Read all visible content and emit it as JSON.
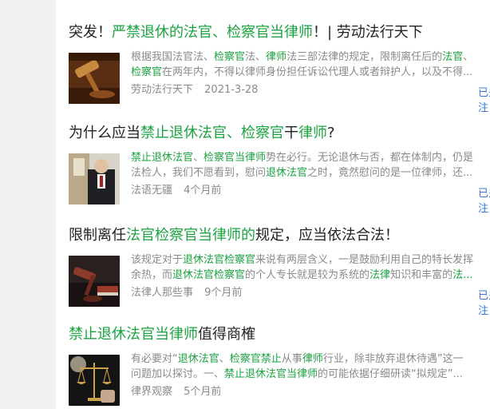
{
  "articles": [
    {
      "title": [
        {
          "t": "突发！",
          "h": false
        },
        {
          "t": "严禁退休的法官、检察官当律师",
          "h": true
        },
        {
          "t": "！| 劳动法行天下",
          "h": false
        }
      ],
      "summary_lines": [
        [
          {
            "t": "根据我国法官法、",
            "h": false
          },
          {
            "t": "检察官",
            "h": true
          },
          {
            "t": "法、",
            "h": false
          },
          {
            "t": "律师",
            "h": true
          },
          {
            "t": "法三部法律的规定，限制离任后的",
            "h": false
          },
          {
            "t": "法官",
            "h": true
          },
          {
            "t": "、",
            "h": false
          }
        ],
        [
          {
            "t": "检察官",
            "h": true
          },
          {
            "t": "在两年内，不得以律师身份担任诉讼代理人或者辩护人，以及不得...",
            "h": false
          }
        ]
      ],
      "source": "劳动法行天下",
      "date": "2021-3-28",
      "follow": "已关注"
    },
    {
      "title": [
        {
          "t": "为什么应当",
          "h": false
        },
        {
          "t": "禁止退休法官、检察官",
          "h": true
        },
        {
          "t": "干",
          "h": false
        },
        {
          "t": "律师",
          "h": true
        },
        {
          "t": "?",
          "h": false
        }
      ],
      "summary_lines": [
        [
          {
            "t": "禁止退休法官",
            "h": true
          },
          {
            "t": "、",
            "h": false
          },
          {
            "t": "检察官当律师",
            "h": true
          },
          {
            "t": "势在必行。无论退休与否，都在体制内，仍是",
            "h": false
          }
        ],
        [
          {
            "t": "法检人，我们不愿看到，慰问",
            "h": false
          },
          {
            "t": "退休法官",
            "h": true
          },
          {
            "t": "之时，竟然慰问的是一位律师，还...",
            "h": false
          }
        ]
      ],
      "source": "法语无疆",
      "date": "4个月前",
      "follow": "已关注"
    },
    {
      "title": [
        {
          "t": "限制离任",
          "h": false
        },
        {
          "t": "法官检察官当律师的",
          "h": true
        },
        {
          "t": "规定，应当依法合法！",
          "h": false
        }
      ],
      "summary_lines": [
        [
          {
            "t": "该规定对于",
            "h": false
          },
          {
            "t": "退休法官检察官",
            "h": true
          },
          {
            "t": "来说有两层含义，一是鼓励利用自己的特长发挥",
            "h": false
          }
        ],
        [
          {
            "t": "余热，而",
            "h": false
          },
          {
            "t": "退休法官检察官",
            "h": true
          },
          {
            "t": "的个人专长就是较为系统的",
            "h": false
          },
          {
            "t": "法律",
            "h": true
          },
          {
            "t": "知识和丰富的",
            "h": false
          },
          {
            "t": "法...",
            "h": true
          }
        ]
      ],
      "source": "法律人那些事",
      "date": "9个月前",
      "follow": "已关注"
    },
    {
      "title": [
        {
          "t": "禁止退休法官当律师",
          "h": true
        },
        {
          "t": "值得商榷",
          "h": false
        }
      ],
      "summary_lines": [
        [
          {
            "t": "有必要对“",
            "h": false
          },
          {
            "t": "退休法官",
            "h": true
          },
          {
            "t": "、",
            "h": false
          },
          {
            "t": "检察官禁止",
            "h": true
          },
          {
            "t": "从事",
            "h": false
          },
          {
            "t": "律师",
            "h": true
          },
          {
            "t": "行业，除非放弃退休待遇”这一",
            "h": false
          }
        ],
        [
          {
            "t": "问题加以探讨。一、",
            "h": false
          },
          {
            "t": "禁止退休法官当律师",
            "h": true
          },
          {
            "t": "的可能依据仔细研读“拟规定”...",
            "h": false
          }
        ]
      ],
      "source": "律界观察",
      "date": "5个月前",
      "follow": ""
    }
  ]
}
